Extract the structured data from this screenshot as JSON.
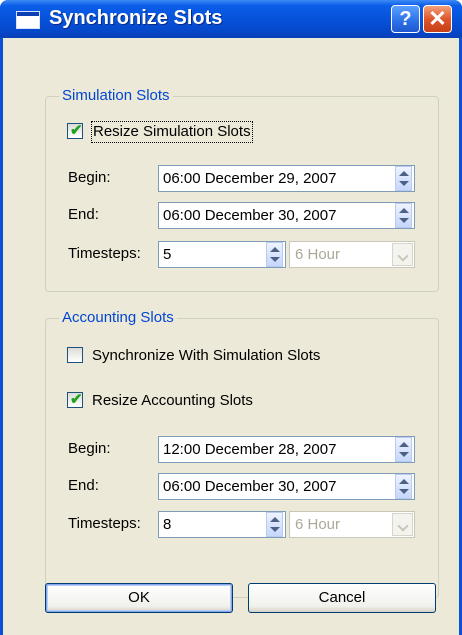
{
  "window": {
    "title": "Synchronize Slots",
    "help_label": "?",
    "close_label": "✕"
  },
  "simulation": {
    "legend": "Simulation Slots",
    "resize_label": "Resize Simulation Slots",
    "resize_checked": true,
    "begin_label": "Begin:",
    "begin_value": "06:00 December 29, 2007",
    "end_label": "End:",
    "end_value": "06:00 December 30, 2007",
    "timesteps_label": "Timesteps:",
    "timesteps_value": "5",
    "unit_value": "6 Hour"
  },
  "accounting": {
    "legend": "Accounting Slots",
    "sync_label": "Synchronize With Simulation Slots",
    "sync_checked": false,
    "resize_label": "Resize Accounting Slots",
    "resize_checked": true,
    "begin_label": "Begin:",
    "begin_value": "12:00 December 28, 2007",
    "end_label": "End:",
    "end_value": "06:00 December 30, 2007",
    "timesteps_label": "Timesteps:",
    "timesteps_value": "8",
    "unit_value": "6 Hour"
  },
  "buttons": {
    "ok_label": "OK",
    "cancel_label": "Cancel"
  },
  "check_mark": "✔",
  "colors": {
    "title_bar": "#0651d8",
    "legend_text": "#0046d5",
    "face": "#ece9d8",
    "check": "#21a121"
  }
}
